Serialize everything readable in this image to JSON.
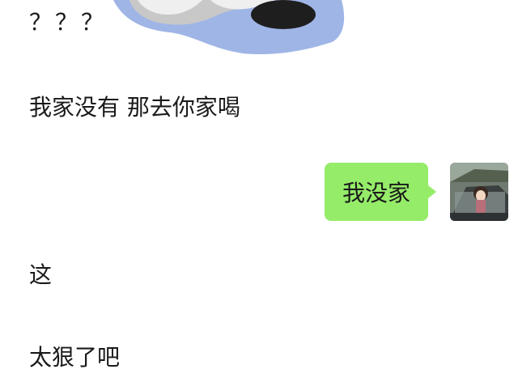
{
  "messages": {
    "line_qqq": "？？？",
    "line_1": "我家没有 那去你家喝",
    "bubble_text": "我没家",
    "line_2": "这",
    "line_3": "太狠了吧"
  },
  "colors": {
    "bubble": "#95ec69",
    "background": "#ffffff",
    "sticker_blue": "#9fb5e6"
  },
  "icons": {
    "sticker": "cloud-sticker-image",
    "avatar": "user-avatar-image"
  }
}
